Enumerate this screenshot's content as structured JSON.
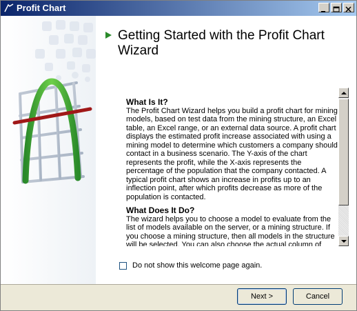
{
  "window": {
    "title": "Profit Chart"
  },
  "titlebar_buttons": [
    {
      "name": "minimize-button",
      "icon": "minimize-icon"
    },
    {
      "name": "maximize-button",
      "icon": "maximize-icon"
    },
    {
      "name": "close-button",
      "icon": "close-icon"
    }
  ],
  "heading": "Getting Started with the Profit Chart Wizard",
  "sections": [
    {
      "title": "What Is It?",
      "body": "The Profit Chart Wizard helps you build a profit chart for mining models, based on test data from the mining structure, an Excel table, an Excel range, or an external data source. A profit chart displays the estimated profit increase associated with using a mining model to determine which customers a company should contact in a business scenario. The Y-axis of the chart represents the profit, while the X-axis represents the percentage of the population that the company contacted. A typical profit chart shows an increase in profits up to an inflection point, after which profits decrease as more of the population is contacted."
    },
    {
      "title": "What Does It Do?",
      "body": "The wizard helps you to choose a model to evaluate from the list of models available on the server, or a mining structure. If you choose a mining structure, then all models in the structure will be selected. You can also choose the actual column of"
    }
  ],
  "checkbox": {
    "label": "Do not show this welcome page again.",
    "checked": false
  },
  "buttons": {
    "next": "Next >",
    "cancel": "Cancel"
  },
  "colors": {
    "title_gradient_start": "#0a246a",
    "title_gradient_end": "#a6caf0",
    "arrow": "#2a8a2a",
    "curve": "#3aa63a",
    "threshold_line": "#a01818"
  }
}
